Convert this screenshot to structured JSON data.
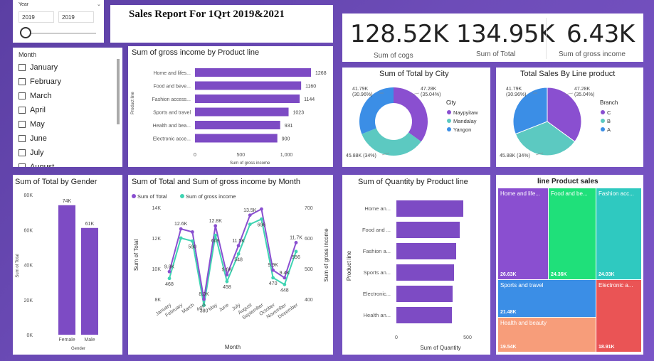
{
  "slicer_year": {
    "label": "Year",
    "from": "2019",
    "to": "2019"
  },
  "report_title": "Sales Report For  1Qrt 2019&2021",
  "kpis": [
    {
      "value": "128.52K",
      "label": "Sum of cogs"
    },
    {
      "value": "134.95K",
      "label": "Sum of Total"
    },
    {
      "value": "6.43K",
      "label": "Sum of gross income"
    }
  ],
  "month_slicer": {
    "label": "Month",
    "items": [
      "January",
      "February",
      "March",
      "April",
      "May",
      "June",
      "July",
      "August"
    ]
  },
  "gross_by_product": {
    "title": "Sum of gross income by Product line",
    "ylabel": "Product line",
    "xlabel": "Sum of gross income",
    "ticks": [
      "0",
      "500",
      "1,000"
    ],
    "categories": [
      "Home and lifes...",
      "Food and beve...",
      "Fashion access...",
      "Sports and travel",
      "Health and bea...",
      "Electronic acce..."
    ],
    "values": [
      1268,
      1160,
      1144,
      1023,
      931,
      900
    ],
    "value_labels": [
      "1268",
      "1160",
      "1144",
      "1023",
      "931",
      "900"
    ]
  },
  "total_by_city": {
    "title": "Sum of Total by City",
    "legend_title": "City",
    "legend": [
      "Naypyitaw",
      "Mandalay",
      "Yangon"
    ],
    "colors": [
      "#8a4fd0",
      "#5cc9c1",
      "#3b8ee6"
    ],
    "values": [
      47.28,
      45.88,
      41.79
    ],
    "labels": [
      "47.28K\n(35.04%)",
      "45.88K (34%)",
      "41.79K\n(30.96%)"
    ]
  },
  "sales_by_line": {
    "title": "Total Sales By Line product",
    "legend_title": "Branch",
    "legend": [
      "C",
      "B",
      "A"
    ],
    "colors": [
      "#8a4fd0",
      "#5cc9c1",
      "#3b8ee6"
    ],
    "values": [
      47.28,
      45.88,
      41.79
    ],
    "labels": [
      "47.28K\n(35.04%)",
      "45.88K (34%)",
      "41.79K\n(30.96%)"
    ]
  },
  "total_by_gender": {
    "title": "Sum of Total by Gender",
    "ylabel": "Sum of Total",
    "xlabel": "Gender",
    "yticks": [
      "80K",
      "60K",
      "40K",
      "20K",
      "0K"
    ],
    "categories": [
      "Female",
      "Male"
    ],
    "values": [
      74,
      61
    ],
    "value_labels": [
      "74K",
      "61K"
    ]
  },
  "by_month": {
    "title": "Sum of Total and Sum of gross income by Month",
    "legend": [
      "Sum of Total",
      "Sum of gross income"
    ],
    "colors": [
      "#8a4fd0",
      "#3fd4b2"
    ],
    "ylabel_left": "Sum of Total",
    "ylabel_right": "Sum of gross income",
    "xlabel": "Month",
    "yticks_left": [
      "14K",
      "12K",
      "10K",
      "8K"
    ],
    "yticks_right": [
      "700",
      "600",
      "500",
      "400"
    ],
    "months": [
      "January",
      "February",
      "March",
      "April",
      "May",
      "June",
      "July",
      "August",
      "September",
      "October",
      "November",
      "December"
    ],
    "total": [
      9.8,
      12.6,
      12.4,
      8.0,
      12.8,
      9.6,
      11.5,
      13.5,
      13.9,
      9.9,
      9.4,
      11.7
    ],
    "gross": [
      468,
      600,
      590,
      380,
      609,
      458,
      548,
      645,
      662,
      470,
      448,
      556
    ],
    "total_labels": [
      "9.8K",
      "12.6K",
      "",
      "8.0K",
      "12.8K",
      "9.6K",
      "11.5K",
      "13.5K",
      "",
      "9.9K",
      "9.4K",
      "11.7K"
    ],
    "gross_labels": [
      "468",
      "",
      "590",
      "380",
      "609",
      "458",
      "548",
      "",
      "696",
      "470",
      "448",
      "556"
    ]
  },
  "qty_by_product": {
    "title": "Sum of Quantity by Product line",
    "ylabel": "Product line",
    "xlabel": "Sum of Quantity",
    "ticks": [
      "0",
      "500"
    ],
    "categories": [
      "Home an...",
      "Food and ...",
      "Fashion a...",
      "Sports an...",
      "Electronic...",
      "Health an..."
    ],
    "values": [
      470,
      445,
      420,
      405,
      395,
      390
    ]
  },
  "treemap": {
    "title": "line Product sales",
    "items": [
      {
        "name": "Home and life...",
        "value": "26.63K",
        "color": "#8a4fd0"
      },
      {
        "name": "Food and be...",
        "value": "24.36K",
        "color": "#1fe07a"
      },
      {
        "name": "Fashion acc...",
        "value": "24.03K",
        "color": "#2fc9c0"
      },
      {
        "name": "Sports and travel",
        "value": "21.48K",
        "color": "#3b8ee6"
      },
      {
        "name": "Electronic a...",
        "value": "18.91K",
        "color": "#ea5455"
      },
      {
        "name": "Health and beauty",
        "value": "19.54K",
        "color": "#f79d7a"
      }
    ]
  }
}
